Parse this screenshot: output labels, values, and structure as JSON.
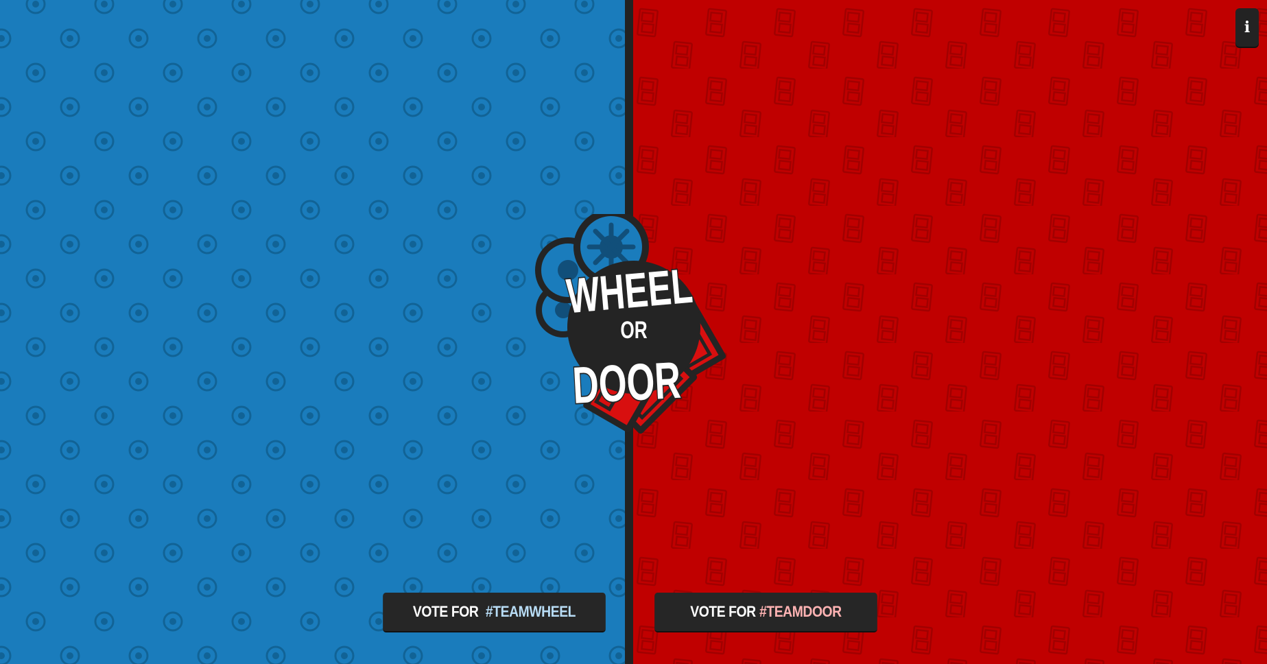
{
  "logo": {
    "line1": "WHEEL",
    "line2": "OR",
    "line3": "DOOR"
  },
  "info_button": {
    "label": "i",
    "icon": "info-icon"
  },
  "vote_wheel": {
    "prefix": "VOTE FOR",
    "tag": "#TEAMWHEEL"
  },
  "vote_door": {
    "prefix": "VOTE FOR",
    "tag": "#TEAMDOOR"
  },
  "colors": {
    "team_wheel": "#1a7cbc",
    "team_door": "#c00000",
    "dark": "#242424"
  }
}
